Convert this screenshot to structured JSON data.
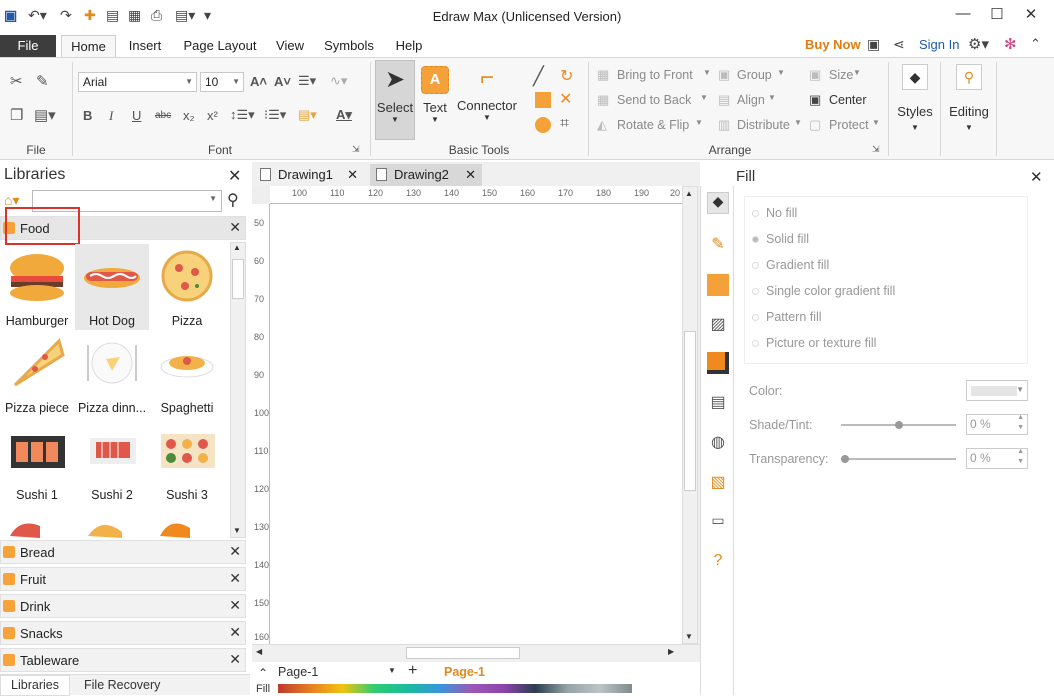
{
  "app": {
    "title": "Edraw Max (Unlicensed Version)"
  },
  "ribbon_tabs": [
    "File",
    "Home",
    "Insert",
    "Page Layout",
    "View",
    "Symbols",
    "Help"
  ],
  "header_right": {
    "buy_now": "Buy Now",
    "sign_in": "Sign In"
  },
  "font": {
    "family": "Arial",
    "size": "10"
  },
  "groups": {
    "file": "File",
    "font": "Font",
    "basic_tools": "Basic Tools",
    "arrange": "Arrange"
  },
  "basic_tools": {
    "select": "Select",
    "text": "Text",
    "connector": "Connector"
  },
  "arrange": {
    "bring_to_front": "Bring to Front",
    "send_to_back": "Send to Back",
    "rotate_flip": "Rotate & Flip",
    "group": "Group",
    "align": "Align",
    "distribute": "Distribute",
    "size": "Size",
    "center": "Center",
    "protect": "Protect"
  },
  "styles": "Styles",
  "editing": "Editing",
  "libraries": {
    "title": "Libraries",
    "search_placeholder": "",
    "open_category": "Food",
    "shapes": [
      "Hamburger",
      "Hot Dog",
      "Pizza",
      "Pizza piece",
      "Pizza dinn...",
      "Spaghetti",
      "Sushi 1",
      "Sushi 2",
      "Sushi 3"
    ],
    "categories": [
      "Bread",
      "Fruit",
      "Drink",
      "Snacks",
      "Tableware"
    ],
    "bottom_tabs": [
      "Libraries",
      "File Recovery"
    ]
  },
  "documents": [
    "Drawing1",
    "Drawing2"
  ],
  "ruler": {
    "h": [
      "100",
      "110",
      "120",
      "130",
      "140",
      "150",
      "160",
      "170",
      "180",
      "190",
      "20"
    ],
    "v": [
      "50",
      "60",
      "70",
      "80",
      "90",
      "100",
      "110",
      "120",
      "130",
      "140",
      "150",
      "160"
    ]
  },
  "page_bar": {
    "page_select": "Page-1",
    "active_page": "Page-1",
    "fill_label": "Fill"
  },
  "fill": {
    "title": "Fill",
    "options": [
      "No fill",
      "Solid fill",
      "Gradient fill",
      "Single color gradient fill",
      "Pattern fill",
      "Picture or texture fill"
    ],
    "selected": "Solid fill",
    "color_label": "Color:",
    "shade_label": "Shade/Tint:",
    "shade_value": "0 %",
    "transparency_label": "Transparency:",
    "transparency_value": "0 %"
  },
  "colors": {
    "accent_orange": "#f5a13a",
    "buy_now": "#e07d10",
    "file_tab": "#3d3d3d",
    "highlight_box": "#d9342b"
  }
}
